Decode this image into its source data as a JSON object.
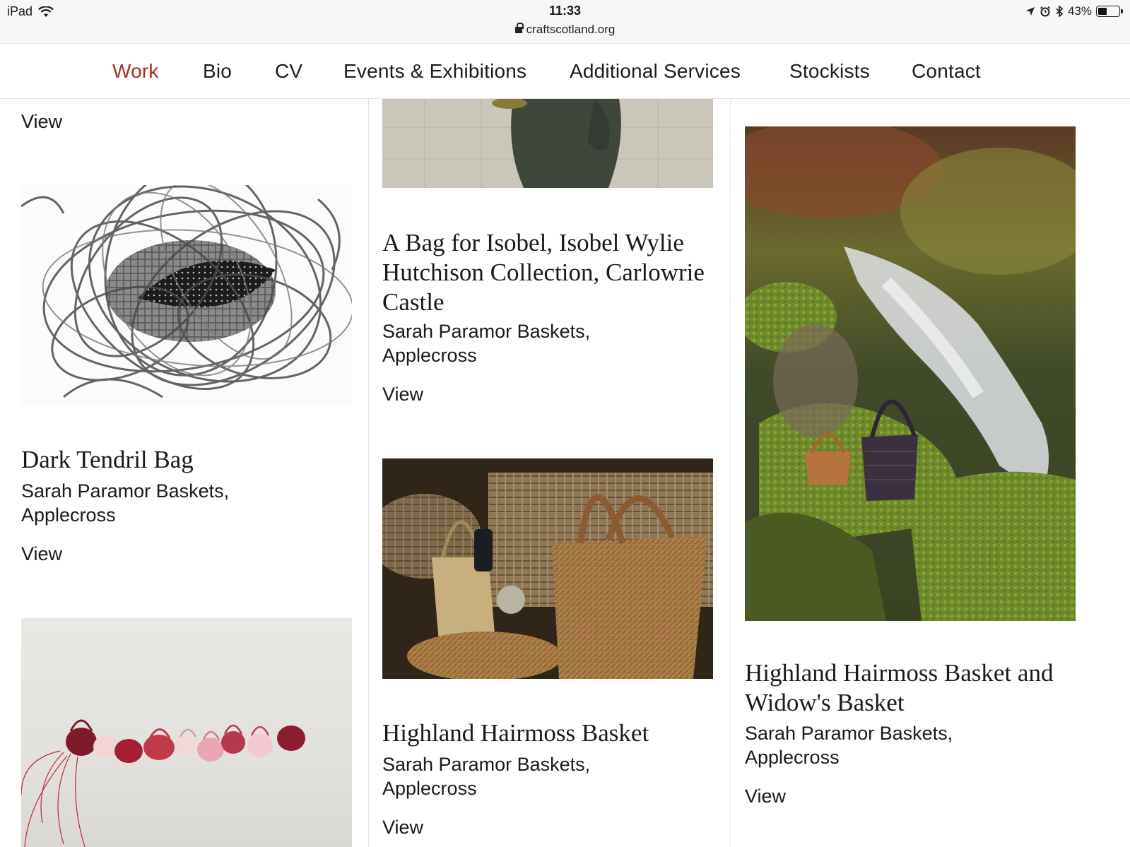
{
  "status_bar": {
    "device": "iPad",
    "time": "11:33",
    "url": "craftscotland.org",
    "battery": "43%",
    "battery_level": 0.43
  },
  "nav": {
    "items": [
      {
        "label": "Work",
        "active": true
      },
      {
        "label": "Bio"
      },
      {
        "label": "CV"
      },
      {
        "label": "Events & Exhibitions"
      },
      {
        "label": "Additional Services"
      },
      {
        "label": "Stockists"
      },
      {
        "label": "Contact"
      }
    ]
  },
  "view_label": "View",
  "items": {
    "dark_tendril": {
      "title": "Dark Tendril Bag",
      "maker": "Sarah Paramor Baskets,",
      "place": "Applecross"
    },
    "bag_for_isobel": {
      "title": "A Bag for Isobel, Isobel Wylie Hutchison Collection, Carlowrie Castle",
      "maker": "Sarah Paramor Baskets,",
      "place": "Applecross"
    },
    "hairmoss_basket": {
      "title": "Highland Hairmoss Basket",
      "maker": "Sarah Paramor Baskets,",
      "place": "Applecross"
    },
    "hairmoss_widow": {
      "title": "Highland Hairmoss Basket and Widow's Basket",
      "maker": "Sarah Paramor Baskets,",
      "place": "Applecross"
    }
  },
  "colors": {
    "nav_active": "#a4301c",
    "text": "#1a1a1a",
    "divider": "#e6e6e6"
  }
}
